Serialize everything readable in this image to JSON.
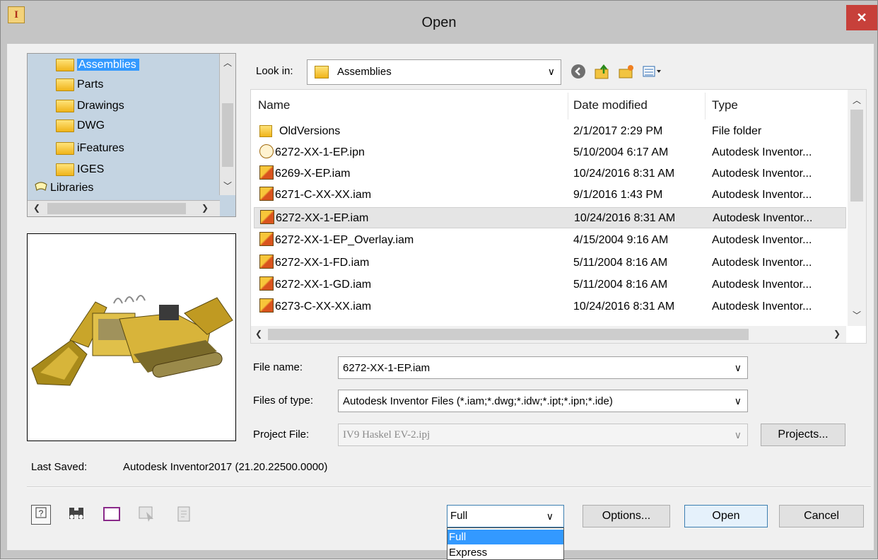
{
  "window": {
    "title": "Open",
    "close_glyph": "✕",
    "app_icon_glyph": "I"
  },
  "tree": {
    "items": [
      {
        "label": "Assemblies",
        "selected": true,
        "icon": "folder-icon"
      },
      {
        "label": "Parts",
        "icon": "folder-icon"
      },
      {
        "label": "Drawings",
        "icon": "folder-icon"
      },
      {
        "label": "DWG",
        "icon": "folder-icon"
      },
      {
        "label": "iFeatures",
        "icon": "folder-icon"
      },
      {
        "label": "IGES",
        "icon": "folder-icon"
      },
      {
        "label": "Libraries",
        "icon": "libraries-icon"
      }
    ]
  },
  "lookin": {
    "label": "Look in:",
    "value": "Assemblies"
  },
  "toolbar": {
    "back_icon": "back-icon",
    "up_icon": "up-folder-icon",
    "new_folder_icon": "new-folder-icon",
    "views_icon": "views-menu-icon"
  },
  "files": {
    "columns": {
      "name": "Name",
      "date": "Date modified",
      "type": "Type"
    },
    "rows": [
      {
        "name": "OldVersions",
        "date": "2/1/2017 2:29 PM",
        "type": "File folder",
        "icon": "folder-icon"
      },
      {
        "name": "6272-XX-1-EP.ipn",
        "date": "5/10/2004 6:17 AM",
        "type": "Autodesk Inventor...",
        "icon": "ipn-file-icon"
      },
      {
        "name": "6269-X-EP.iam",
        "date": "10/24/2016 8:31 AM",
        "type": "Autodesk Inventor...",
        "icon": "assembly-file-icon"
      },
      {
        "name": "6271-C-XX-XX.iam",
        "date": "9/1/2016 1:43 PM",
        "type": "Autodesk Inventor...",
        "icon": "assembly-file-icon"
      },
      {
        "name": "6272-XX-1-EP.iam",
        "date": "10/24/2016 8:31 AM",
        "type": "Autodesk Inventor...",
        "icon": "assembly-file-icon",
        "selected": true
      },
      {
        "name": "6272-XX-1-EP_Overlay.iam",
        "date": "4/15/2004 9:16 AM",
        "type": "Autodesk Inventor...",
        "icon": "assembly-file-icon"
      },
      {
        "name": "6272-XX-1-FD.iam",
        "date": "5/11/2004 8:16 AM",
        "type": "Autodesk Inventor...",
        "icon": "assembly-file-icon"
      },
      {
        "name": "6272-XX-1-GD.iam",
        "date": "5/11/2004 8:16 AM",
        "type": "Autodesk Inventor...",
        "icon": "assembly-file-icon"
      },
      {
        "name": "6273-C-XX-XX.iam",
        "date": "10/24/2016 8:31 AM",
        "type": "Autodesk Inventor...",
        "icon": "assembly-file-icon"
      }
    ]
  },
  "form": {
    "file_name_label": "File name:",
    "file_name_value": "6272-XX-1-EP.iam",
    "files_of_type_label": "Files of type:",
    "files_of_type_value": "Autodesk Inventor Files (*.iam;*.dwg;*.idw;*.ipt;*.ipn;*.ide)",
    "project_file_label": "Project File:",
    "project_file_value": "IV9 Haskel EV-2.ipj",
    "projects_button": "Projects..."
  },
  "last_saved": {
    "label": "Last Saved:",
    "value": "Autodesk Inventor2017 (21.20.22500.0000)"
  },
  "bottom": {
    "mode_value": "Full",
    "mode_options": [
      "Full",
      "Express"
    ],
    "options_button": "Options...",
    "open_button": "Open",
    "cancel_button": "Cancel"
  },
  "colors": {
    "selection": "#3399ff",
    "close": "#c7403a",
    "tree_bg": "#c4d4e2",
    "chrome": "#c5c5c5"
  }
}
